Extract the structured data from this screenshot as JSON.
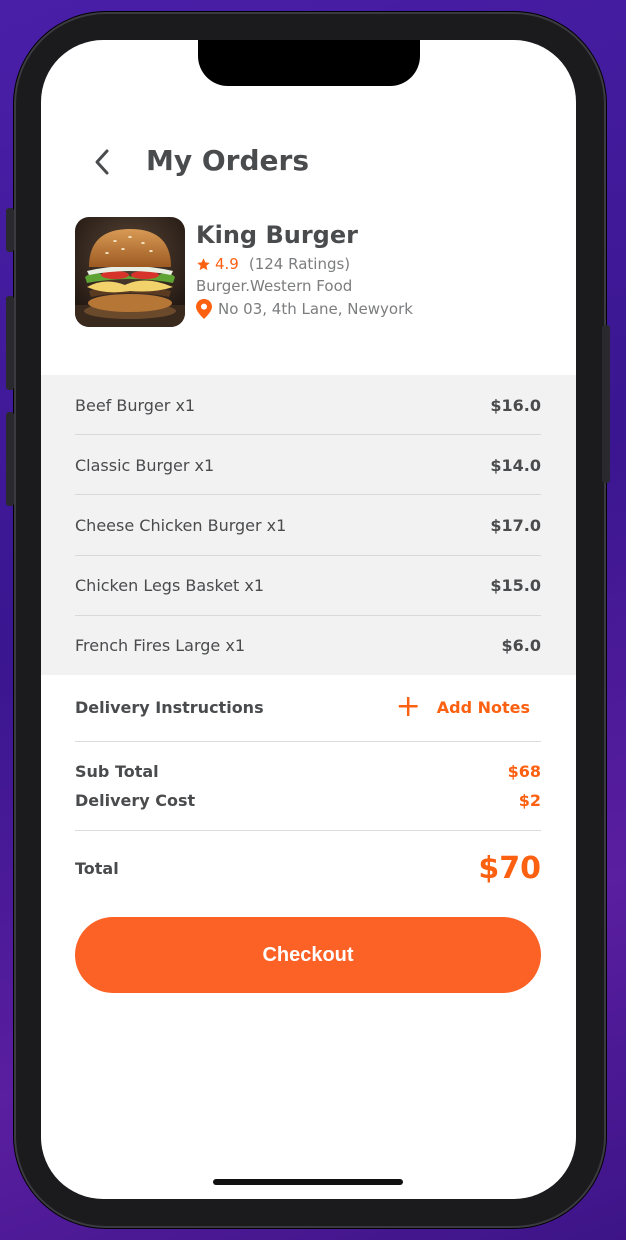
{
  "header": {
    "title": "My Orders",
    "back_icon": "chevron-left-icon"
  },
  "restaurant": {
    "name": "King Burger",
    "rating": "4.9",
    "ratings_count": "(124 Ratings)",
    "cuisine": "Burger.Western Food",
    "address": "No 03, 4th Lane, Newyork"
  },
  "order_items": [
    {
      "name": "Beef Burger x1",
      "price": "$16.0"
    },
    {
      "name": "Classic Burger x1",
      "price": "$14.0"
    },
    {
      "name": "Cheese Chicken Burger x1",
      "price": "$17.0"
    },
    {
      "name": "Chicken Legs Basket x1",
      "price": "$15.0"
    },
    {
      "name": "French Fires Large x1",
      "price": "$6.0"
    }
  ],
  "delivery": {
    "label": "Delivery Instructions",
    "add_notes": "Add Notes"
  },
  "summary": {
    "subtotal_label": "Sub Total",
    "subtotal": "$68",
    "delivery_label": "Delivery Cost",
    "delivery_cost": "$2",
    "total_label": "Total",
    "total": "$70"
  },
  "checkout_label": "Checkout",
  "colors": {
    "accent": "#fc6011",
    "button": "#fc6226",
    "text": "#4a4b4d",
    "muted": "#7c7d7e",
    "items_bg": "#f2f2f2"
  }
}
